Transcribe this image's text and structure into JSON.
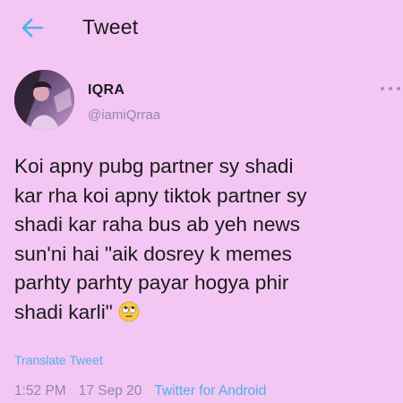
{
  "header": {
    "back_icon": "arrow-left-icon",
    "title": "Tweet"
  },
  "user": {
    "name": "IQRA",
    "handle": "@iamiQrraa",
    "avatar_icon": "profile-photo"
  },
  "tweet": {
    "lines": [
      "Koi apny pubg partner sy shadi",
      "kar rha koi apny tiktok partner sy",
      "shadi kar raha bus ab yeh news",
      "sun'ni hai \"aik dosrey k memes",
      "parhty parhty payar hogya phir",
      "shadi karli\""
    ],
    "emoji": "face-with-rolling-eyes",
    "translate_label": "Translate Tweet"
  },
  "meta": {
    "time": "1:52 PM",
    "date": "17 Sep 20",
    "source": "Twitter for Android"
  },
  "colors": {
    "background": "#f3c6f3",
    "accent": "#4fb0e8",
    "muted": "#8e8aa8",
    "text": "#1a1a1a"
  }
}
